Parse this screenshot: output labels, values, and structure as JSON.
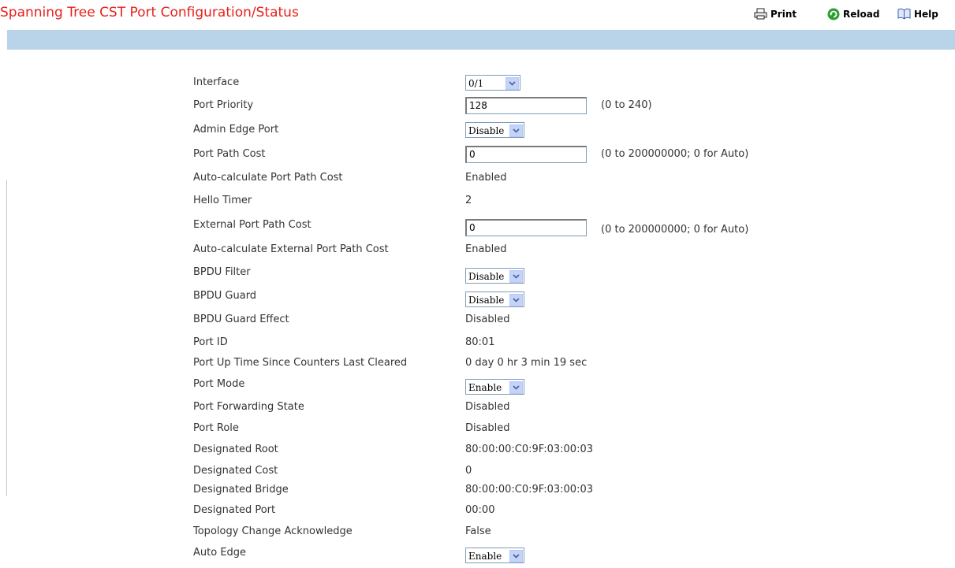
{
  "header": {
    "title": "Spanning Tree CST Port Configuration/Status",
    "print_label": "Print",
    "reload_label": "Reload",
    "help_label": "Help"
  },
  "form": {
    "interface": {
      "label": "Interface",
      "value": "0/1"
    },
    "port_priority": {
      "label": "Port Priority",
      "value": "128",
      "hint": "(0 to 240)"
    },
    "admin_edge_port": {
      "label": "Admin Edge Port",
      "value": "Disable"
    },
    "port_path_cost": {
      "label": "Port Path Cost",
      "value": "0",
      "hint": "(0 to 200000000; 0 for Auto)"
    },
    "auto_calc_path_cost": {
      "label": "Auto-calculate Port Path Cost",
      "value": "Enabled"
    },
    "hello_timer": {
      "label": "Hello Timer",
      "value": "2"
    },
    "external_path_cost": {
      "label": "External Port Path Cost",
      "value": "0",
      "hint": "(0 to 200000000; 0 for Auto)"
    },
    "auto_calc_ext_path_cost": {
      "label": "Auto-calculate External Port Path Cost",
      "value": "Enabled"
    },
    "bpdu_filter": {
      "label": "BPDU Filter",
      "value": "Disable"
    },
    "bpdu_guard": {
      "label": "BPDU Guard",
      "value": "Disable"
    },
    "bpdu_guard_effect": {
      "label": "BPDU Guard Effect",
      "value": "Disabled"
    },
    "port_id": {
      "label": "Port ID",
      "value": "80:01"
    },
    "port_up_time": {
      "label": "Port Up Time Since Counters Last Cleared",
      "value": "0 day 0 hr 3 min 19 sec"
    },
    "port_mode": {
      "label": "Port Mode",
      "value": "Enable"
    },
    "port_forwarding_state": {
      "label": "Port Forwarding State",
      "value": "Disabled"
    },
    "port_role": {
      "label": "Port Role",
      "value": "Disabled"
    },
    "designated_root": {
      "label": "Designated Root",
      "value": "80:00:00:C0:9F:03:00:03"
    },
    "designated_cost": {
      "label": "Designated Cost",
      "value": "0"
    },
    "designated_bridge": {
      "label": "Designated Bridge",
      "value": "80:00:00:C0:9F:03:00:03"
    },
    "designated_port": {
      "label": "Designated Port",
      "value": "00:00"
    },
    "topology_change_ack": {
      "label": "Topology Change Acknowledge",
      "value": "False"
    },
    "auto_edge": {
      "label": "Auto Edge",
      "value": "Enable"
    }
  },
  "colors": {
    "title": "#e8201c",
    "band": "#b9d3e8",
    "reload_icon": "#2e9e2e"
  },
  "icons": {
    "print": "printer-icon",
    "reload": "reload-icon",
    "help": "help-book-icon",
    "dropdown": "chevron-down-icon"
  }
}
